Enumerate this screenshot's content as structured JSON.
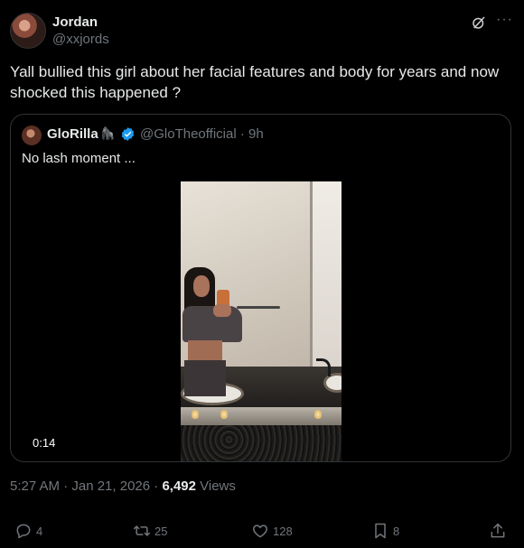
{
  "author": {
    "name": "Jordan",
    "handle": "@xxjords"
  },
  "tweet": {
    "text": "Yall bullied this girl about her facial features and body for years and now shocked this happened ?"
  },
  "quoted": {
    "name": "GloRilla",
    "emoji": "🦍",
    "handle_time": "@GloTheofficial · 9h",
    "text": "No lash moment ...",
    "video_duration": "0:14"
  },
  "meta": {
    "timestamp": "5:27 AM · Jan 21, 2026 · ",
    "views_count": "6,492",
    "views_label": " Views"
  },
  "actions": {
    "replies": "4",
    "reposts": "25",
    "likes": "128",
    "bookmarks": "8"
  },
  "icons": {
    "reply": "reply-icon",
    "repost": "repost-icon",
    "like": "heart-icon",
    "bookmark": "bookmark-icon",
    "share": "share-icon",
    "grok": "grok-icon",
    "more": "more-icon",
    "verified": "verified-icon"
  },
  "colors": {
    "background": "#000000",
    "text": "#e7e9ea",
    "secondary": "#71767b",
    "verified": "#1d9bf0",
    "border": "#2f3336"
  }
}
